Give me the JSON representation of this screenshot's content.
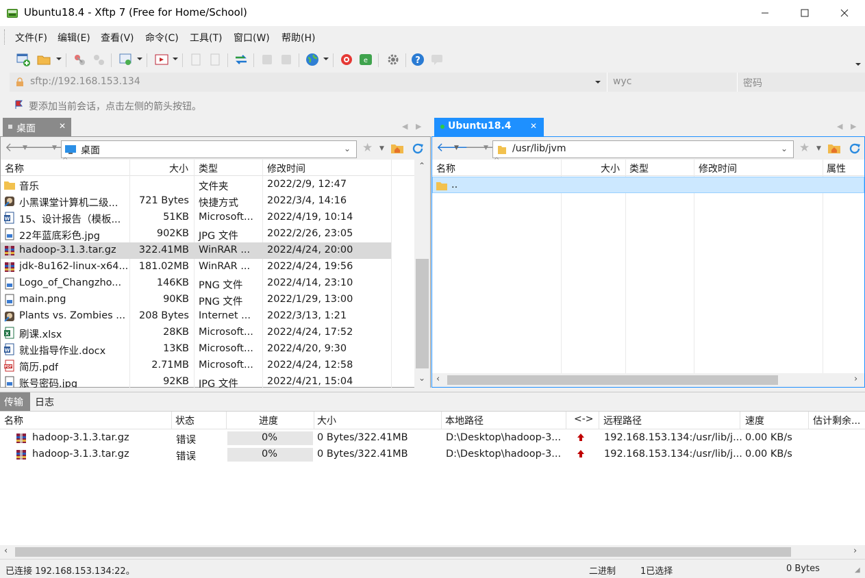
{
  "window": {
    "title": "Ubuntu18.4 - Xftp 7 (Free for Home/School)"
  },
  "menu": [
    "文件(F)",
    "编辑(E)",
    "查看(V)",
    "命令(C)",
    "工具(T)",
    "窗口(W)",
    "帮助(H)"
  ],
  "address": {
    "url": "sftp://192.168.153.134",
    "user_placeholder": "wyc",
    "password_placeholder": "密码"
  },
  "hint": "要添加当前会话，点击左侧的箭头按钮。",
  "local": {
    "tab_label": "桌面",
    "path": "桌面",
    "columns": [
      "名称",
      "大小",
      "类型",
      "修改时间"
    ],
    "files": [
      {
        "name": "音乐",
        "size": "",
        "type": "文件夹",
        "modified": "2022/2/9, 12:47",
        "icon": "folder-icon"
      },
      {
        "name": "小黑课堂计算机二级...",
        "size": "721 Bytes",
        "type": "快捷方式",
        "modified": "2022/3/4, 14:16",
        "icon": "shortcut-icon"
      },
      {
        "name": "15、设计报告（模板...",
        "size": "51KB",
        "type": "Microsoft...",
        "modified": "2022/4/19, 10:14",
        "icon": "word-icon"
      },
      {
        "name": "22年蓝底彩色.jpg",
        "size": "902KB",
        "type": "JPG 文件",
        "modified": "2022/2/26, 23:05",
        "icon": "image-icon"
      },
      {
        "name": "hadoop-3.1.3.tar.gz",
        "size": "322.41MB",
        "type": "WinRAR ...",
        "modified": "2022/4/24, 20:00",
        "icon": "archive-icon",
        "selected": true
      },
      {
        "name": "jdk-8u162-linux-x64...",
        "size": "181.02MB",
        "type": "WinRAR ...",
        "modified": "2022/4/24, 19:56",
        "icon": "archive-icon"
      },
      {
        "name": "Logo_of_Changzho...",
        "size": "146KB",
        "type": "PNG 文件",
        "modified": "2022/4/14, 23:10",
        "icon": "image-icon"
      },
      {
        "name": "main.png",
        "size": "90KB",
        "type": "PNG 文件",
        "modified": "2022/1/29, 13:00",
        "icon": "image-icon"
      },
      {
        "name": "Plants vs. Zombies ...",
        "size": "208 Bytes",
        "type": "Internet ...",
        "modified": "2022/3/13, 1:21",
        "icon": "shortcut-icon"
      },
      {
        "name": "刷课.xlsx",
        "size": "28KB",
        "type": "Microsoft...",
        "modified": "2022/4/24, 17:52",
        "icon": "excel-icon"
      },
      {
        "name": "就业指导作业.docx",
        "size": "13KB",
        "type": "Microsoft...",
        "modified": "2022/4/20, 9:30",
        "icon": "word-icon"
      },
      {
        "name": "简历.pdf",
        "size": "2.71MB",
        "type": "Microsoft...",
        "modified": "2022/4/24, 12:58",
        "icon": "pdf-icon"
      },
      {
        "name": "账号密码.jpg",
        "size": "92KB",
        "type": "JPG 文件",
        "modified": "2022/4/21, 15:04",
        "icon": "image-icon"
      }
    ]
  },
  "remote": {
    "tab_label": "Ubuntu18.4",
    "path": "/usr/lib/jvm",
    "columns": [
      "名称",
      "大小",
      "类型",
      "修改时间",
      "属性"
    ],
    "files": [
      {
        "name": "..",
        "icon": "folder-icon",
        "selected": true
      }
    ]
  },
  "transfer": {
    "tabs": [
      "传输",
      "日志"
    ],
    "columns": [
      "名称",
      "状态",
      "进度",
      "大小",
      "本地路径",
      "<->",
      "远程路径",
      "速度",
      "估计剩余..."
    ],
    "rows": [
      {
        "name": "hadoop-3.1.3.tar.gz",
        "status": "错误",
        "progress": "0%",
        "progress_value": 0,
        "size": "0 Bytes/322.41MB",
        "local_path": "D:\\Desktop\\hadoop-3...",
        "direction": "upload-arrow-icon",
        "remote_path": "192.168.153.134:/usr/lib/j...",
        "speed": "0.00 KB/s",
        "eta": ""
      },
      {
        "name": "hadoop-3.1.3.tar.gz",
        "status": "错误",
        "progress": "0%",
        "progress_value": 0,
        "size": "0 Bytes/322.41MB",
        "local_path": "D:\\Desktop\\hadoop-3...",
        "direction": "upload-arrow-icon",
        "remote_path": "192.168.153.134:/usr/lib/j...",
        "speed": "0.00 KB/s",
        "eta": ""
      }
    ]
  },
  "status": {
    "connection": "已连接 192.168.153.134:22。",
    "mode": "二进制",
    "selection": "1已选择",
    "bytes": "0 Bytes"
  },
  "colors": {
    "accent": "#1e90ff",
    "selected_row": "#cce8ff",
    "local_selected": "#d9d9d9",
    "error_arrow": "#c00000"
  }
}
